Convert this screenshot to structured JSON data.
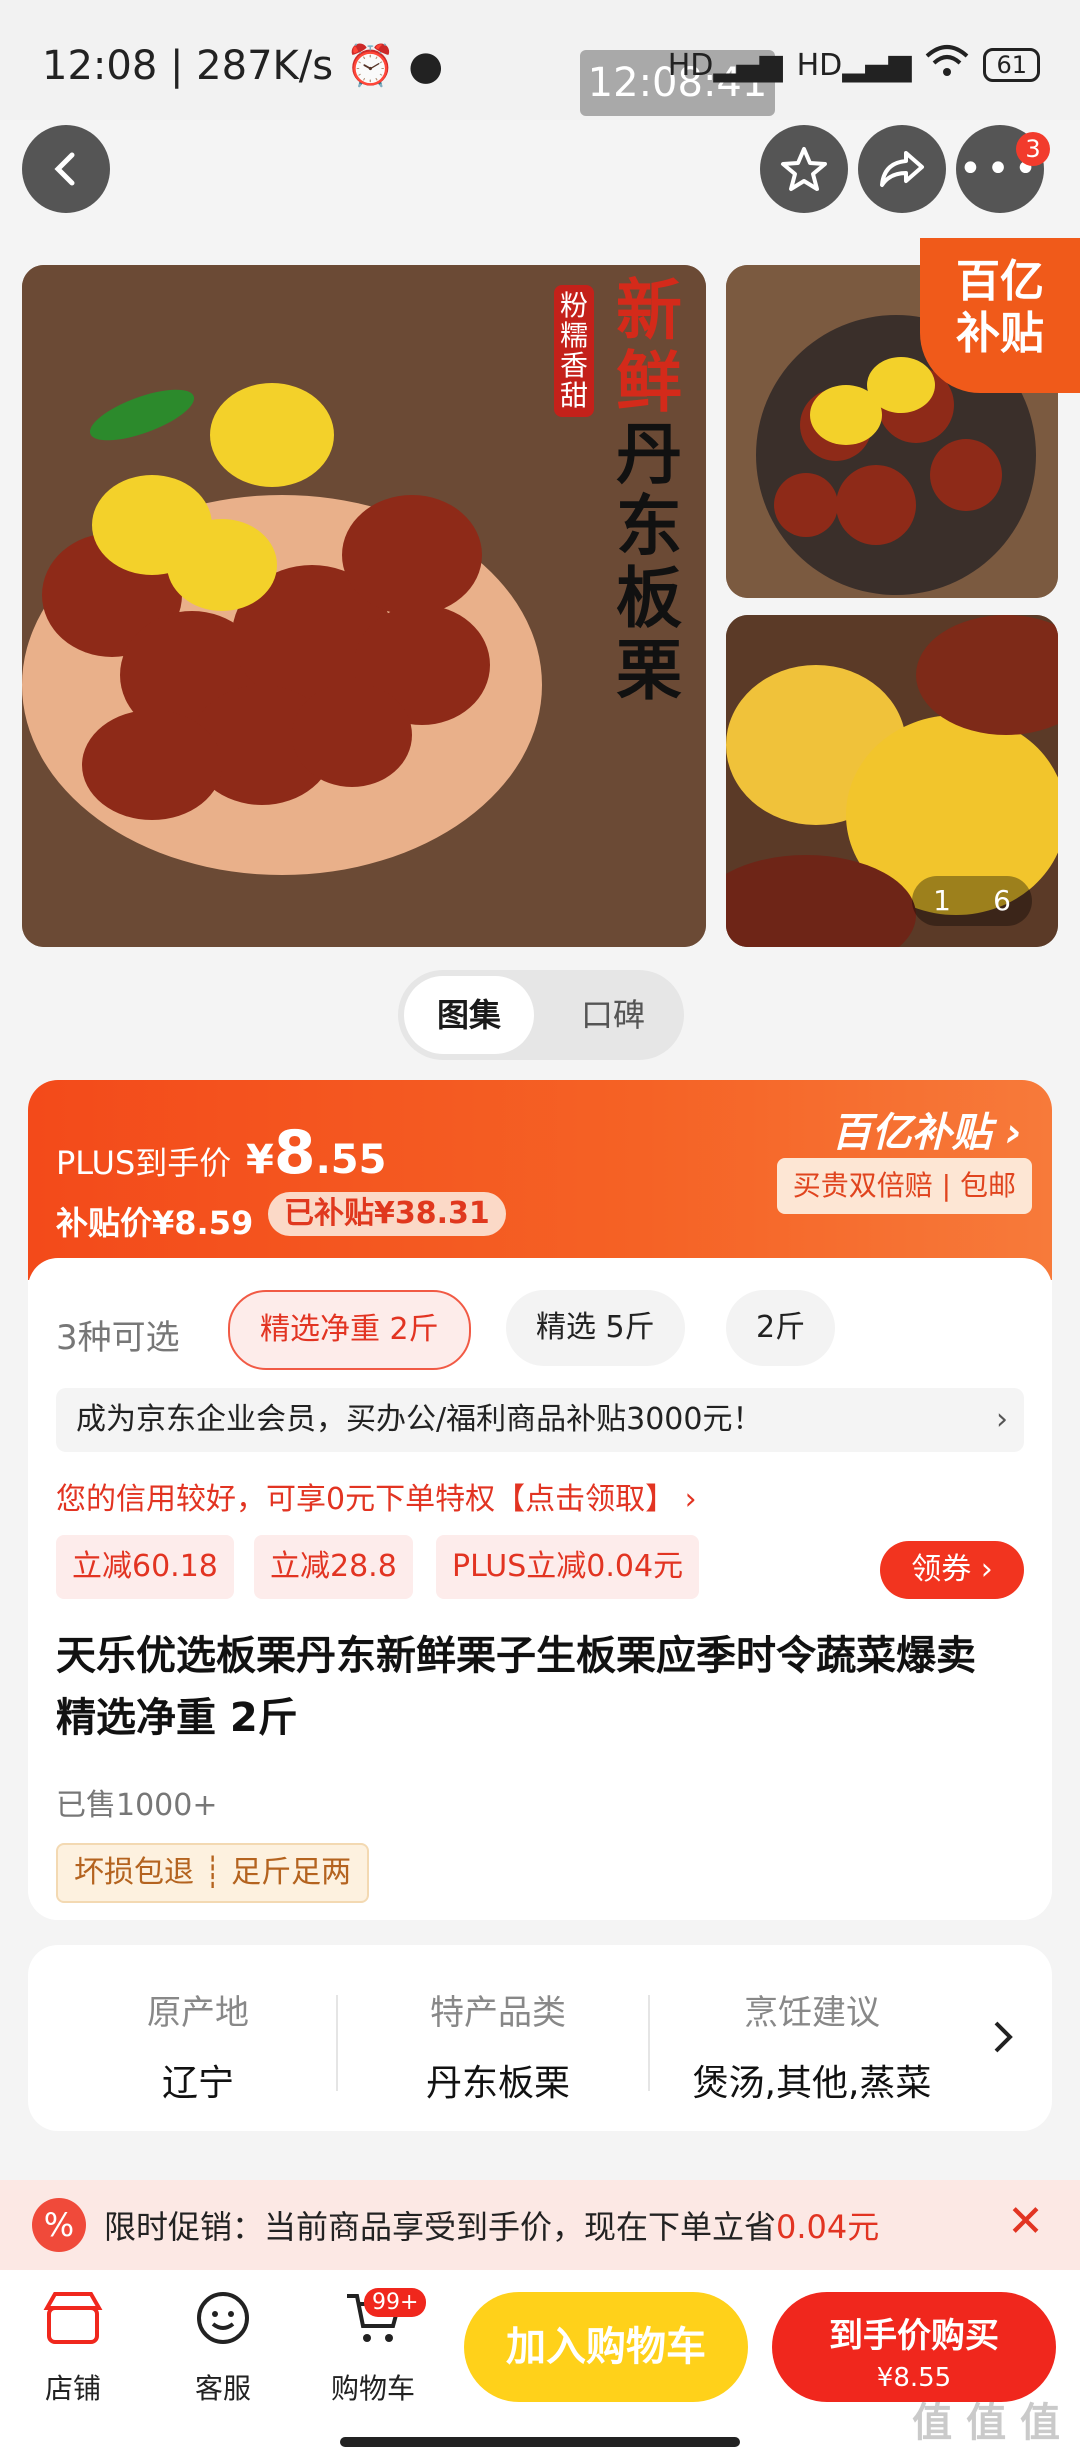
{
  "status_bar": {
    "time_speed": "12:08 | 287K/s",
    "clock_overlay": "12:08:41",
    "battery": "61"
  },
  "nav": {
    "cart_badge": "3"
  },
  "gallery": {
    "main_tag": "粉糯香甜",
    "main_title_red": "新鲜",
    "main_title_black": "丹东板栗",
    "corner_logo_line1": "百亿",
    "corner_logo_line2": "补贴",
    "page_current": "1",
    "page_total": "6"
  },
  "segment": {
    "active": "图集",
    "inactive": "口碑"
  },
  "price": {
    "plus_label": "PLUS到手价",
    "currency": "¥",
    "amount_int": "8",
    "amount_dec": ".55",
    "subsidy_price": "补贴价¥8.59",
    "subsidy_saved": "已补贴¥38.31",
    "logo": "百亿补贴 ›",
    "guarantee": "买贵双倍赔 | 包邮"
  },
  "options": {
    "count": "3种可选",
    "items": [
      "精选净重 2斤",
      "精选 5斤",
      "2斤"
    ]
  },
  "promo_bar": {
    "text": "成为京东企业会员，买办公/福利商品补贴3000元！",
    "chevron": "›"
  },
  "credit": "您的信用较好，可享0元下单特权【点击领取】 ›",
  "coupons": [
    "立减60.18",
    "立减28.8",
    "PLUS立减0.04元"
  ],
  "get_coupon": "领券 ›",
  "product_title": "天乐优选板栗丹东新鲜栗子生板栗应季时令蔬菜爆卖 精选净重 2斤",
  "sold": "已售1000+",
  "services": "坏损包退 ┊ 足斤足两",
  "attributes": [
    {
      "key": "原产地",
      "value": "辽宁"
    },
    {
      "key": "特产品类",
      "value": "丹东板栗"
    },
    {
      "key": "烹饪建议",
      "value": "煲汤,其他,蒸菜"
    }
  ],
  "strip": {
    "text_prefix": "限时促销：当前商品享受到手价，现在下单立省",
    "text_amount": "0.04元"
  },
  "bottom": {
    "tabs": [
      "店铺",
      "客服",
      "购物车"
    ],
    "cart_count": "99+",
    "add_cart": "加入购物车",
    "buy_now": "到手价购买",
    "buy_price": "¥8.55"
  },
  "watermark": "值 值 值"
}
